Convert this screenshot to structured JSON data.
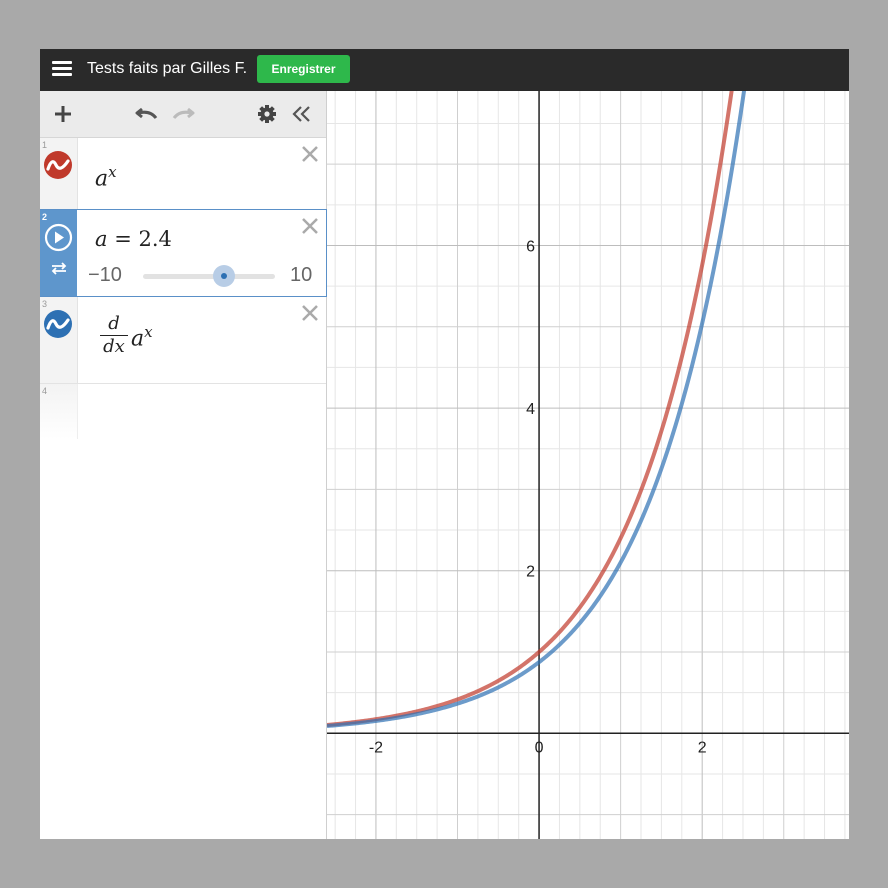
{
  "header": {
    "title": "Tests faits par Gilles F.",
    "save_label": "Enregistrer"
  },
  "expressions": [
    {
      "number": "1",
      "base": "a",
      "exponent": "x",
      "color": "#c0392b"
    },
    {
      "number": "2",
      "lhs": "a",
      "equals": "=",
      "value": "2.4",
      "slider": {
        "min_label": "−10",
        "max_label": "10",
        "min": -10,
        "max": 10,
        "value": 2.4
      }
    },
    {
      "number": "3",
      "deriv_num": "d",
      "deriv_den": "dx",
      "base": "a",
      "exponent": "x",
      "color": "#2d70b3"
    },
    {
      "number": "4"
    }
  ],
  "icons": {
    "menu": "hamburger-menu-icon",
    "add": "plus-icon",
    "undo": "undo-icon",
    "redo": "redo-icon",
    "settings": "gear-icon",
    "collapse": "double-chevron-left-icon",
    "close": "close-icon",
    "play": "play-icon",
    "loop": "loop-icon",
    "curve": "sine-wave-icon"
  },
  "colors": {
    "red_curve": "#c0392b",
    "blue_curve": "#2d70b3",
    "save_button": "#2eb84b",
    "active_tab": "#5e96cc"
  },
  "chart_data": {
    "type": "line",
    "xlim": [
      -2.6,
      3.8
    ],
    "ylim": [
      -1.3,
      7.9
    ],
    "grid": true,
    "x_ticks": [
      "-2",
      "0",
      "2"
    ],
    "y_ticks": [
      "2",
      "4",
      "6"
    ],
    "a": 2.4,
    "series": [
      {
        "expression": "a^x",
        "color": "#c0392b",
        "x": [
          -2.6,
          -2,
          -1,
          0,
          1,
          1.5,
          2,
          2.3
        ],
        "y": [
          0.1,
          0.17,
          0.42,
          1.0,
          2.4,
          3.72,
          5.76,
          7.5
        ]
      },
      {
        "expression": "d/dx a^x",
        "color": "#2d70b3",
        "x": [
          -2.6,
          -2,
          -1,
          0,
          1,
          1.5,
          2,
          2.5
        ],
        "y": [
          0.09,
          0.15,
          0.36,
          0.88,
          2.1,
          3.25,
          5.04,
          7.8
        ]
      }
    ]
  }
}
